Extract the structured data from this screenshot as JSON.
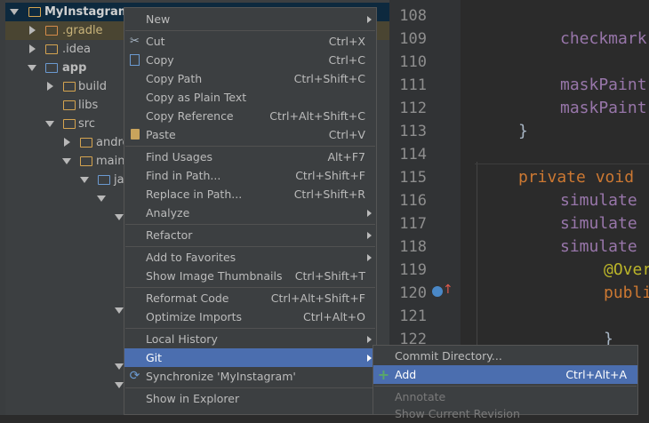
{
  "project_tree": {
    "items": [
      {
        "label": "MyInstagram",
        "bold": true
      },
      {
        "label": ".gradle"
      },
      {
        "label": ".idea"
      },
      {
        "label": "app",
        "bold": true
      },
      {
        "label": "build"
      },
      {
        "label": "libs"
      },
      {
        "label": "src"
      },
      {
        "label": "andro"
      },
      {
        "label": "main"
      },
      {
        "label": "ja"
      }
    ]
  },
  "editor": {
    "line_numbers": [
      "108",
      "109",
      "110",
      "111",
      "112",
      "113",
      "114",
      "115",
      "116",
      "117",
      "118",
      "119",
      "120",
      "121",
      "122"
    ],
    "code_fragments": {
      "l109": "checkmark",
      "l111": "maskPaint",
      "l112": "maskPaint",
      "l113": "}",
      "l115_kw": "private void",
      "l116": "simulate",
      "l117": "simulate",
      "l118": "simulate",
      "l119": "@Over",
      "l120": "publi",
      "l122": "}"
    }
  },
  "context_menu": {
    "items": [
      {
        "label": "New",
        "shortcut": "",
        "submenu": true
      },
      {
        "label": "Cut",
        "shortcut": "Ctrl+X",
        "icon": "scissors-icon"
      },
      {
        "label": "Copy",
        "shortcut": "Ctrl+C",
        "icon": "copy-icon"
      },
      {
        "label": "Copy Path",
        "shortcut": "Ctrl+Shift+C"
      },
      {
        "label": "Copy as Plain Text",
        "shortcut": ""
      },
      {
        "label": "Copy Reference",
        "shortcut": "Ctrl+Alt+Shift+C"
      },
      {
        "label": "Paste",
        "shortcut": "Ctrl+V",
        "icon": "paste-icon"
      },
      {
        "label": "Find Usages",
        "shortcut": "Alt+F7"
      },
      {
        "label": "Find in Path...",
        "shortcut": "Ctrl+Shift+F"
      },
      {
        "label": "Replace in Path...",
        "shortcut": "Ctrl+Shift+R"
      },
      {
        "label": "Analyze",
        "shortcut": "",
        "submenu": true
      },
      {
        "label": "Refactor",
        "shortcut": "",
        "submenu": true
      },
      {
        "label": "Add to Favorites",
        "shortcut": "",
        "submenu": true
      },
      {
        "label": "Show Image Thumbnails",
        "shortcut": "Ctrl+Shift+T"
      },
      {
        "label": "Reformat Code",
        "shortcut": "Ctrl+Alt+Shift+F"
      },
      {
        "label": "Optimize Imports",
        "shortcut": "Ctrl+Alt+O"
      },
      {
        "label": "Local History",
        "shortcut": "",
        "submenu": true
      },
      {
        "label": "Git",
        "shortcut": "",
        "submenu": true
      },
      {
        "label": "Synchronize 'MyInstagram'",
        "shortcut": "",
        "icon": "sync-icon"
      },
      {
        "label": "Show in Explorer",
        "shortcut": ""
      }
    ]
  },
  "git_submenu": {
    "items": [
      {
        "label": "Commit Directory...",
        "shortcut": ""
      },
      {
        "label": "Add",
        "shortcut": "Ctrl+Alt+A",
        "icon": "plus-icon"
      },
      {
        "label": "Annotate",
        "shortcut": ""
      },
      {
        "label": "Show Current Revision",
        "shortcut": ""
      }
    ]
  },
  "colors": {
    "menu_bg": "#3c3f41",
    "highlight": "#4b6eaf",
    "keyword": "#cc7832",
    "field": "#9876aa",
    "annotation": "#bbb529",
    "line_number": "#8e8e8e"
  }
}
